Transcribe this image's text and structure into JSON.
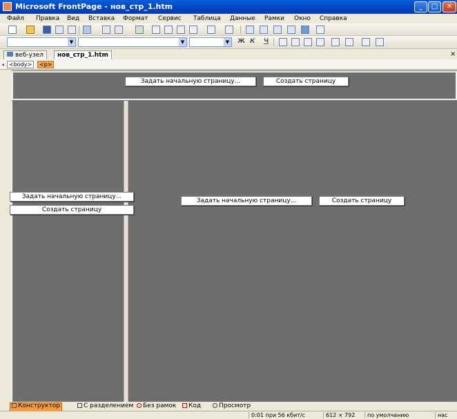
{
  "window": {
    "title": "Microsoft FrontPage - нов_стр_1.htm",
    "minimize": "_",
    "maximize": "□",
    "close": "✕"
  },
  "menu": [
    "Файл",
    "Правка",
    "Вид",
    "Вставка",
    "Формат",
    "Сервис",
    "Таблица",
    "Данные",
    "Рамки",
    "Окно",
    "Справка"
  ],
  "format_toolbar": {
    "style_value": "",
    "font_value": "",
    "size_value": "",
    "bold": "Ж",
    "italic": "К",
    "underline": "Ч"
  },
  "tabs": [
    {
      "label": "веб-узел",
      "active": false
    },
    {
      "label": "нов_стр_1.htm",
      "active": true
    }
  ],
  "tab_close": "×",
  "tagbar": {
    "body": "<body>",
    "p": "<p>"
  },
  "frames": {
    "top": {
      "set_start": "Задать начальную страницу...",
      "create": "Создать страницу"
    },
    "left": {
      "set_start": "Задать начальную страницу...",
      "create": "Создать страницу"
    },
    "main": {
      "set_start": "Задать начальную страницу...",
      "create": "Создать страницу"
    }
  },
  "view_tabs": [
    {
      "label": "Конструктор",
      "active": true
    },
    {
      "label": "С разделением",
      "active": false
    },
    {
      "label": "Без рамок",
      "active": false
    },
    {
      "label": "Код",
      "active": false
    },
    {
      "label": "Просмотр",
      "active": false
    }
  ],
  "status": {
    "download": "0:01 при 56 кбит/с",
    "page_size": "612 × 792",
    "mode": "по умолчанию",
    "extra": "нас"
  },
  "colors": {
    "titlebar": "#0348c7",
    "frame_bg": "#6e6e6e",
    "active_view": "#ff9c31",
    "selected_tag": "#f6a44a"
  }
}
